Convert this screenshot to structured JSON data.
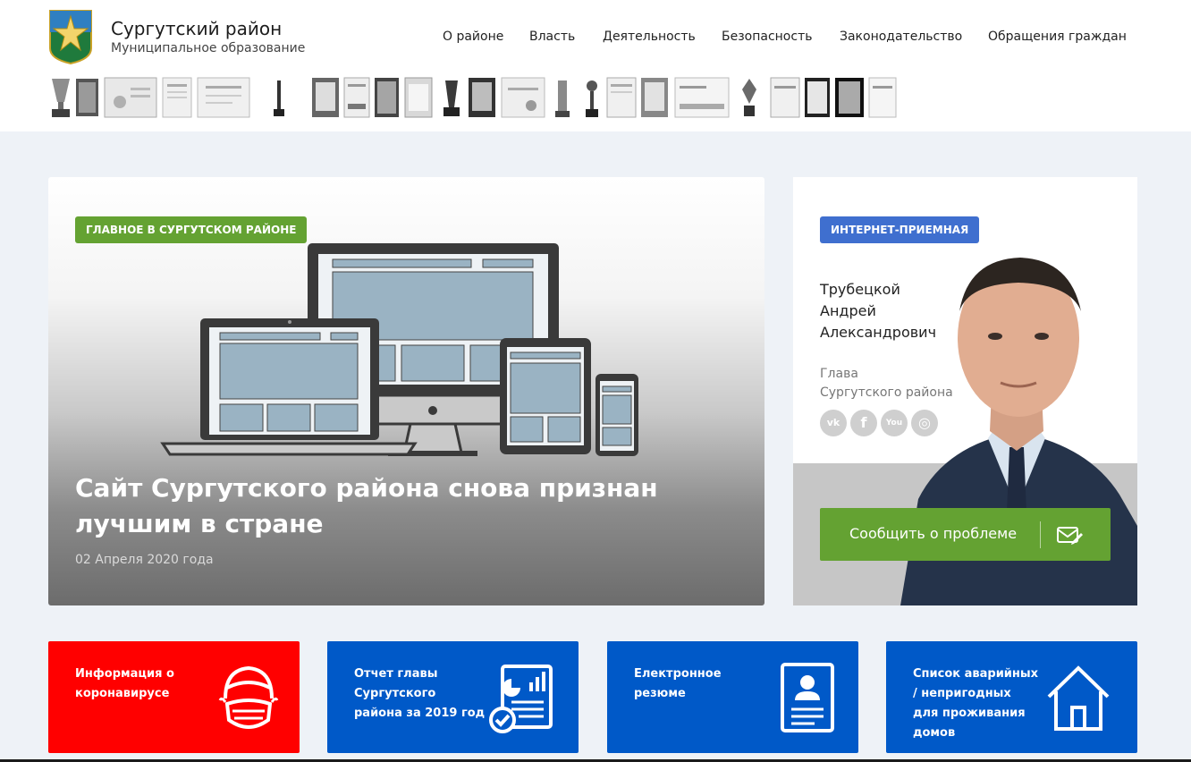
{
  "header": {
    "title": "Сургутский район",
    "subtitle": "Муниципальное образование",
    "logo_icon": "coat-of-arms-icon",
    "nav": [
      {
        "label": "О районе"
      },
      {
        "label": "Власть"
      },
      {
        "label": "Деятельность"
      },
      {
        "label": "Безопасность"
      },
      {
        "label": "Законодательство"
      },
      {
        "label": "Обращения граждан"
      }
    ]
  },
  "awards": {
    "items": [
      "cup-award-icon",
      "plaque-award-icon",
      "certificate-award-icon",
      "diploma-award-icon",
      "certificate-award-icon",
      "statuette-award-icon",
      "plaque-award-icon",
      "certificate-award-icon",
      "plaque-award-icon",
      "diploma-award-icon",
      "statuette-award-icon",
      "plaque-award-icon",
      "certificate-award-icon",
      "statuette-award-icon",
      "statuette-award-icon",
      "diploma-award-icon",
      "plaque-award-icon",
      "certificate-award-icon",
      "statuette-award-icon",
      "diploma-award-icon",
      "plaque-award-icon",
      "plaque-award-icon",
      "diploma-award-icon"
    ]
  },
  "hero": {
    "tag": "ГЛАВНОЕ В СУРГУТСКОМ РАЙОНЕ",
    "title": "Сайт Сургутского района снова признан лучшим в стране",
    "date": "02 Апреля 2020 года",
    "image_icon": "devices-illustration-icon",
    "tag_color": "#64a232"
  },
  "reception": {
    "tag": "ИНТЕРНЕТ-ПРИЕМНАЯ",
    "name_lines": [
      "Трубецкой",
      "Андрей",
      "Александрович"
    ],
    "role_lines": [
      "Глава",
      "Сургутского района"
    ],
    "socials": [
      {
        "label": "vk",
        "icon": "vk-icon"
      },
      {
        "label": "f",
        "icon": "facebook-icon"
      },
      {
        "label": "You",
        "icon": "youtube-icon"
      },
      {
        "label": "◎",
        "icon": "instagram-icon"
      }
    ],
    "button_label": "Сообщить о проблеме",
    "button_icon": "envelope-pen-icon",
    "tag_color": "#3f6fcf",
    "button_color": "#64a232"
  },
  "cards": [
    {
      "lines": [
        "Информация о",
        "коронавирусе"
      ],
      "icon": "face-mask-icon",
      "color": "#ff0000"
    },
    {
      "lines": [
        "Отчет главы",
        "Сургутского",
        "района за 2019 год"
      ],
      "icon": "report-document-icon",
      "color": "#0059c8"
    },
    {
      "lines": [
        "Електронное",
        "резюме"
      ],
      "icon": "resume-icon",
      "color": "#0059c8"
    },
    {
      "lines": [
        "Список аварийных",
        "/ непригодных",
        "для проживания",
        "домов"
      ],
      "icon": "house-icon",
      "color": "#0059c8"
    }
  ]
}
